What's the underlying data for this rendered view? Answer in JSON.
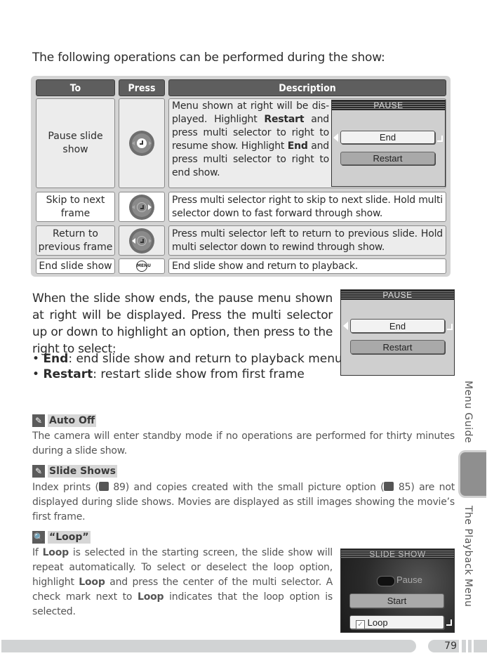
{
  "intro": "The following operations can be performed during the show:",
  "table": {
    "headers": [
      "To",
      "Press",
      "Description"
    ],
    "rows": [
      {
        "to": "Pause slide show",
        "press_icon": "multi-selector-center-icon",
        "description_parts": [
          "Menu shown at right will be dis-played.  Highlight ",
          "Restart",
          " and press multi selector to right to resume show.  Highlight ",
          "End",
          " and press multi selector to right to end show."
        ]
      },
      {
        "to": "Skip to next frame",
        "press_icon": "multi-selector-right-icon",
        "description": "Press multi selector right to skip to next slide.  Hold multi selector down to fast forward through show."
      },
      {
        "to": "Return to previous frame",
        "press_icon": "multi-selector-left-icon",
        "description": "Press multi selector left to return to previous slide.  Hold multi selector down to rewind through show."
      },
      {
        "to": "End slide show",
        "press_icon": "menu-button-icon",
        "press_label": "MENU",
        "description": "End slide show and return to playback."
      }
    ]
  },
  "pause_menu": {
    "title": "PAUSE",
    "options": [
      "End",
      "Restart"
    ],
    "selected": "End"
  },
  "end_section": {
    "text": "When the slide show ends, the pause menu shown at right will be displayed.  Press the multi selector up or down to highlight an option, then press to the right to select:",
    "bullets": [
      {
        "term": "End",
        "text": ": end slide show and return to playback menu"
      },
      {
        "term": "Restart",
        "text": ": restart slide show from first frame"
      }
    ]
  },
  "notes": [
    {
      "icon": "pencil-icon",
      "title": "Auto Off",
      "text": "The camera will enter standby mode if no operations are performed for thirty minutes during a slide show."
    },
    {
      "icon": "pencil-icon",
      "title": "Slide Shows",
      "text_parts": [
        "Index prints (",
        " 89) and copies created with the small picture option (",
        " 85) are not displayed during slide shows.  Movies are displayed as still images showing the movie’s first frame."
      ]
    },
    {
      "icon": "magnifier-icon",
      "title": "“Loop”",
      "text_parts": [
        "If ",
        "Loop",
        " is selected in the starting screen, the slide show will repeat automatically.  To select or deselect the loop option, highlight ",
        "Loop",
        " and press the center of the multi selector.  A check mark next to ",
        "Loop",
        " indicates that the loop option is selected."
      ]
    }
  ],
  "slide_show_screen": {
    "title": "SLIDE SHOW",
    "pause_label": "Pause",
    "start_label": "Start",
    "loop_label": "Loop",
    "loop_checked": true
  },
  "side_tabs": {
    "top": "Menu Guide",
    "bottom": "The Playback Menu"
  },
  "page_number": "79"
}
